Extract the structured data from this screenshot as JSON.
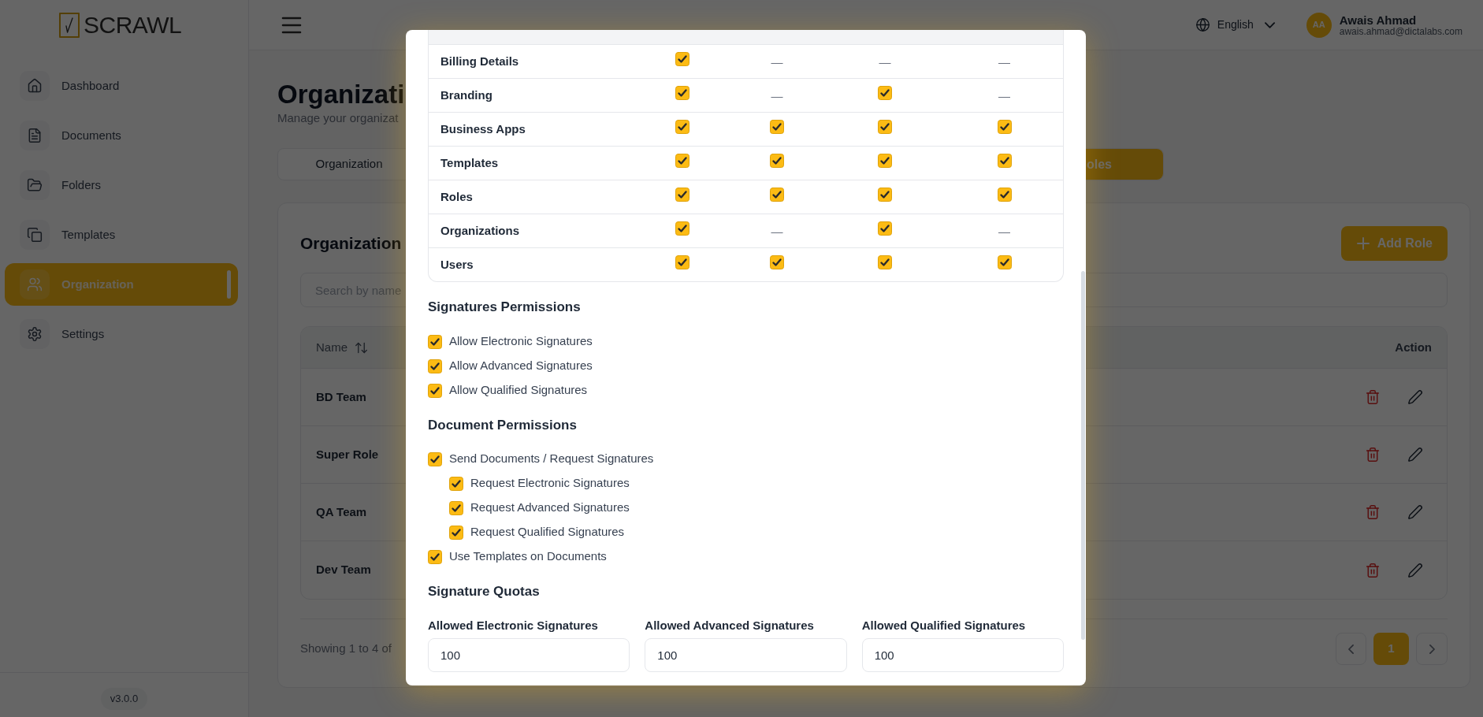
{
  "sidebar": {
    "logo": "SCRAWL",
    "items": [
      {
        "label": "Dashboard",
        "selected": false
      },
      {
        "label": "Documents",
        "selected": false
      },
      {
        "label": "Folders",
        "selected": false
      },
      {
        "label": "Templates",
        "selected": false
      },
      {
        "label": "Organization",
        "selected": true
      },
      {
        "label": "Settings",
        "selected": false
      }
    ],
    "version": "v3.0.0"
  },
  "header": {
    "language": "English",
    "user": {
      "initials": "AA",
      "name": "Awais Ahmad",
      "email": "awais.ahmad@dictalabs.com"
    }
  },
  "page": {
    "title": "Organizati",
    "subtitle": "Manage your organizat"
  },
  "tabs": [
    {
      "label": "Organization",
      "selected": false
    },
    {
      "label": "oles",
      "selected": true
    }
  ],
  "roles_card": {
    "title": "Organization",
    "add_button": "Add Role",
    "search": {
      "placeholder": "Search by name"
    },
    "columns": [
      "Name",
      "Action"
    ],
    "rows": [
      "BD Team",
      "Super Role",
      "QA Team",
      "Dev Team"
    ],
    "summary": "Showing 1 to 4 of",
    "pages": [
      {
        "label": "1",
        "selected": true
      }
    ]
  },
  "modal": {
    "permissions_table": {
      "rows": [
        {
          "name": "Billing Details",
          "cells": [
            {
              "kind": "checkbox",
              "checked": true
            },
            {
              "kind": "dash",
              "text": "—"
            },
            {
              "kind": "dash",
              "text": "—"
            },
            {
              "kind": "dash",
              "text": "—"
            }
          ]
        },
        {
          "name": "Branding",
          "cells": [
            {
              "kind": "checkbox",
              "checked": true
            },
            {
              "kind": "dash",
              "text": "—"
            },
            {
              "kind": "checkbox",
              "checked": true
            },
            {
              "kind": "dash",
              "text": "—"
            }
          ]
        },
        {
          "name": "Business Apps",
          "cells": [
            {
              "kind": "checkbox",
              "checked": true
            },
            {
              "kind": "checkbox",
              "checked": true
            },
            {
              "kind": "checkbox",
              "checked": true
            },
            {
              "kind": "checkbox",
              "checked": true
            }
          ]
        },
        {
          "name": "Templates",
          "cells": [
            {
              "kind": "checkbox",
              "checked": true
            },
            {
              "kind": "checkbox",
              "checked": true
            },
            {
              "kind": "checkbox",
              "checked": true
            },
            {
              "kind": "checkbox",
              "checked": true
            }
          ]
        },
        {
          "name": "Roles",
          "cells": [
            {
              "kind": "checkbox",
              "checked": true
            },
            {
              "kind": "checkbox",
              "checked": true
            },
            {
              "kind": "checkbox",
              "checked": true
            },
            {
              "kind": "checkbox",
              "checked": true
            }
          ]
        },
        {
          "name": "Organizations",
          "cells": [
            {
              "kind": "checkbox",
              "checked": true
            },
            {
              "kind": "dash",
              "text": "—"
            },
            {
              "kind": "checkbox",
              "checked": true
            },
            {
              "kind": "dash",
              "text": "—"
            }
          ]
        },
        {
          "name": "Users",
          "cells": [
            {
              "kind": "checkbox",
              "checked": true
            },
            {
              "kind": "checkbox",
              "checked": true
            },
            {
              "kind": "checkbox",
              "checked": true
            },
            {
              "kind": "checkbox",
              "checked": true
            }
          ]
        }
      ]
    },
    "signatures_permissions": {
      "title": "Signatures Permissions",
      "items": [
        {
          "label": "Allow Electronic Signatures",
          "checked": true
        },
        {
          "label": "Allow Advanced Signatures",
          "checked": true
        },
        {
          "label": "Allow Qualified Signatures",
          "checked": true
        }
      ]
    },
    "document_permissions": {
      "title": "Document Permissions",
      "items": [
        {
          "label": "Send Documents / Request Signatures",
          "checked": true,
          "children": [
            {
              "label": "Request Electronic Signatures",
              "checked": true
            },
            {
              "label": "Request Advanced Signatures",
              "checked": true
            },
            {
              "label": "Request Qualified Signatures",
              "checked": true
            }
          ]
        },
        {
          "label": "Use Templates on Documents",
          "checked": true
        }
      ]
    },
    "signature_quotas": {
      "title": "Signature Quotas",
      "fields": [
        {
          "label": "Allowed Electronic Signatures",
          "value": "100"
        },
        {
          "label": "Allowed Advanced Signatures",
          "value": "100"
        },
        {
          "label": "Allowed Qualified Signatures",
          "value": "100"
        }
      ]
    }
  }
}
